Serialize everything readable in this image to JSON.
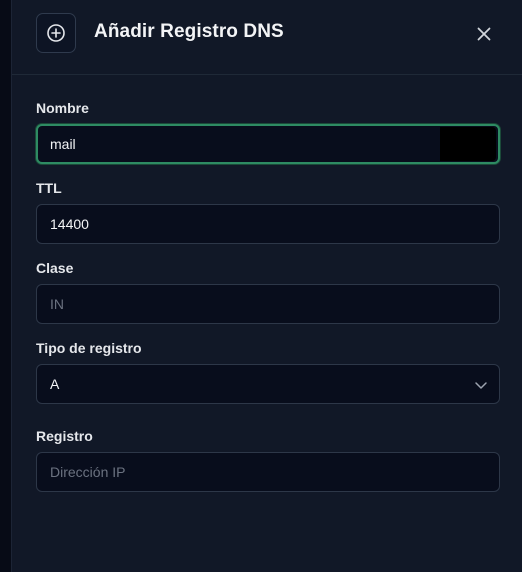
{
  "dialog": {
    "title": "Añadir Registro DNS",
    "header_icon": "plus-circle-icon",
    "close_icon": "close-icon"
  },
  "form": {
    "nombre": {
      "label": "Nombre",
      "value": "mail"
    },
    "ttl": {
      "label": "TTL",
      "value": "14400"
    },
    "clase": {
      "label": "Clase",
      "placeholder": "IN"
    },
    "tipo": {
      "label": "Tipo de registro",
      "selected": "A"
    },
    "registro": {
      "label": "Registro",
      "placeholder": "Dirección IP"
    }
  },
  "colors": {
    "panel_bg": "#111827",
    "input_bg": "#080d1c",
    "focus_border": "#2e8b63"
  }
}
